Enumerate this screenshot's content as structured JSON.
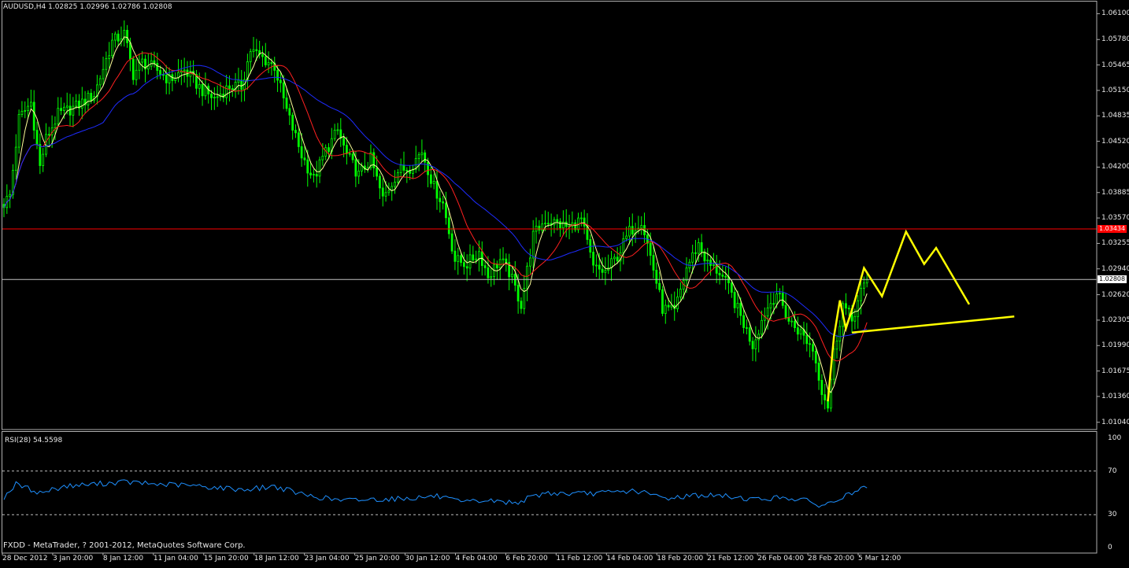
{
  "header": {
    "symbol_line": "AUDUSD,H4  1.02825 1.02996 1.02786 1.02808"
  },
  "rsi": {
    "label": "RSI(28) 54.5598"
  },
  "footer": {
    "copyright": "FXDD - MetaTrader, ? 2001-2012, MetaQuotes Software Corp."
  },
  "colors": {
    "background": "#000000",
    "bull_candle": "#00ff00",
    "bear_candle": "#00ff00",
    "ma_fast": "#ffff99",
    "ma_mid": "#ff2020",
    "ma_slow": "#1e2cff",
    "rsi_line": "#1e90ff",
    "drawing": "#ffff00",
    "resistance_line": "#ff0000",
    "current_price_line": "#c0c0c0"
  },
  "chart_data": [
    {
      "type": "candlestick",
      "title": "AUDUSD,H4",
      "ohlc_last": {
        "open": 1.02825,
        "high": 1.02996,
        "low": 1.02786,
        "close": 1.02808
      },
      "ylim": [
        1.0095,
        1.0625
      ],
      "y_ticks": [
        "1.06100",
        "1.05780",
        "1.05465",
        "1.05150",
        "1.04835",
        "1.04520",
        "1.04200",
        "1.03885",
        "1.03570",
        "1.03255",
        "1.02940",
        "1.02620",
        "1.02305",
        "1.01990",
        "1.01675",
        "1.01360",
        "1.01040"
      ],
      "x_ticks": [
        "28 Dec 2012",
        "3 Jan 20:00",
        "8 Jan 12:00",
        "11 Jan 04:00",
        "15 Jan 20:00",
        "18 Jan 12:00",
        "23 Jan 04:00",
        "25 Jan 20:00",
        "30 Jan 12:00",
        "4 Feb 04:00",
        "6 Feb 20:00",
        "11 Feb 12:00",
        "14 Feb 04:00",
        "18 Feb 20:00",
        "21 Feb 12:00",
        "26 Feb 04:00",
        "28 Feb 20:00",
        "5 Mar 12:00"
      ],
      "close_anchors": [
        [
          0,
          1.0375
        ],
        [
          2,
          1.0385
        ],
        [
          5,
          1.048
        ],
        [
          9,
          1.05
        ],
        [
          12,
          1.042
        ],
        [
          14,
          1.0455
        ],
        [
          18,
          1.0485
        ],
        [
          24,
          1.0495
        ],
        [
          30,
          1.051
        ],
        [
          36,
          1.0575
        ],
        [
          40,
          1.0585
        ],
        [
          43,
          1.0535
        ],
        [
          46,
          1.055
        ],
        [
          51,
          1.054
        ],
        [
          55,
          1.0528
        ],
        [
          60,
          1.054
        ],
        [
          66,
          1.0515
        ],
        [
          70,
          1.0505
        ],
        [
          75,
          1.052
        ],
        [
          79,
          1.052
        ],
        [
          82,
          1.0565
        ],
        [
          86,
          1.0555
        ],
        [
          90,
          1.0545
        ],
        [
          94,
          1.049
        ],
        [
          99,
          1.0435
        ],
        [
          103,
          1.0405
        ],
        [
          107,
          1.044
        ],
        [
          111,
          1.0465
        ],
        [
          114,
          1.0435
        ],
        [
          118,
          1.041
        ],
        [
          122,
          1.043
        ],
        [
          126,
          1.038
        ],
        [
          131,
          1.0415
        ],
        [
          135,
          1.042
        ],
        [
          139,
          1.044
        ],
        [
          143,
          1.0395
        ],
        [
          146,
          1.0375
        ],
        [
          150,
          1.0305
        ],
        [
          154,
          1.03
        ],
        [
          158,
          1.0315
        ],
        [
          161,
          1.0285
        ],
        [
          165,
          1.0305
        ],
        [
          168,
          1.029
        ],
        [
          172,
          1.025
        ],
        [
          176,
          1.0335
        ],
        [
          180,
          1.0355
        ],
        [
          184,
          1.035
        ],
        [
          188,
          1.0345
        ],
        [
          192,
          1.0355
        ],
        [
          196,
          1.0295
        ],
        [
          200,
          1.029
        ],
        [
          204,
          1.031
        ],
        [
          208,
          1.034
        ],
        [
          212,
          1.0355
        ],
        [
          215,
          1.031
        ],
        [
          219,
          1.0245
        ],
        [
          223,
          1.024
        ],
        [
          227,
          1.0295
        ],
        [
          231,
          1.0325
        ],
        [
          234,
          1.03
        ],
        [
          238,
          1.029
        ],
        [
          241,
          1.027
        ],
        [
          245,
          1.0235
        ],
        [
          249,
          1.02
        ],
        [
          253,
          1.024
        ],
        [
          257,
          1.0265
        ],
        [
          261,
          1.023
        ],
        [
          265,
          1.0215
        ],
        [
          269,
          1.0195
        ],
        [
          272,
          1.0145
        ],
        [
          274,
          1.0125
        ],
        [
          276,
          1.019
        ],
        [
          279,
          1.025
        ],
        [
          282,
          1.023
        ],
        [
          285,
          1.0265
        ],
        [
          287,
          1.0275
        ]
      ],
      "moving_averages": [
        {
          "period": 5,
          "color": "#ffff99"
        },
        {
          "period": 14,
          "color": "#ff2020"
        },
        {
          "period": 34,
          "color": "#1e2cff"
        }
      ],
      "horizontal_lines": [
        {
          "value": 1.03434,
          "label": "1.03434",
          "color": "#ff0000"
        },
        {
          "value": 1.02808,
          "label": "1.02808",
          "color": "#c0c0c0"
        }
      ],
      "drawings": [
        {
          "kind": "polyline",
          "color": "#ffff00",
          "points": [
            [
              274,
              1.013
            ],
            [
              276,
              1.021
            ],
            [
              278,
              1.0255
            ],
            [
              280,
              1.022
            ],
            [
              283,
              1.0255
            ],
            [
              286,
              1.0295
            ],
            [
              292,
              1.026
            ],
            [
              300,
              1.034
            ],
            [
              306,
              1.03
            ],
            [
              310,
              1.032
            ],
            [
              321,
              1.025
            ]
          ]
        },
        {
          "kind": "trendline",
          "color": "#ffff00",
          "points": [
            [
              282,
              1.0215
            ],
            [
              336,
              1.0235
            ]
          ]
        }
      ]
    },
    {
      "type": "line",
      "title": "RSI(28)",
      "last_value": 54.5598,
      "ylim": [
        0,
        100
      ],
      "y_ticks": [
        "100",
        "70",
        "30",
        "0"
      ],
      "levels": [
        70,
        30
      ],
      "series": [
        {
          "name": "RSI(28)",
          "anchors": [
            [
              0,
              46
            ],
            [
              4,
              58
            ],
            [
              12,
              50
            ],
            [
              20,
              56
            ],
            [
              30,
              58
            ],
            [
              40,
              60
            ],
            [
              50,
              58
            ],
            [
              60,
              57
            ],
            [
              70,
              55
            ],
            [
              80,
              53
            ],
            [
              90,
              56
            ],
            [
              100,
              48
            ],
            [
              112,
              43
            ],
            [
              122,
              44
            ],
            [
              134,
              45
            ],
            [
              144,
              47
            ],
            [
              152,
              41
            ],
            [
              160,
              43
            ],
            [
              170,
              41
            ],
            [
              180,
              50
            ],
            [
              190,
              49
            ],
            [
              200,
              50
            ],
            [
              210,
              52
            ],
            [
              220,
              45
            ],
            [
              230,
              48
            ],
            [
              240,
              47
            ],
            [
              250,
              44
            ],
            [
              260,
              46
            ],
            [
              268,
              42
            ],
            [
              272,
              38
            ],
            [
              276,
              42
            ],
            [
              282,
              50
            ],
            [
              287,
              54.5598
            ]
          ]
        }
      ]
    }
  ]
}
